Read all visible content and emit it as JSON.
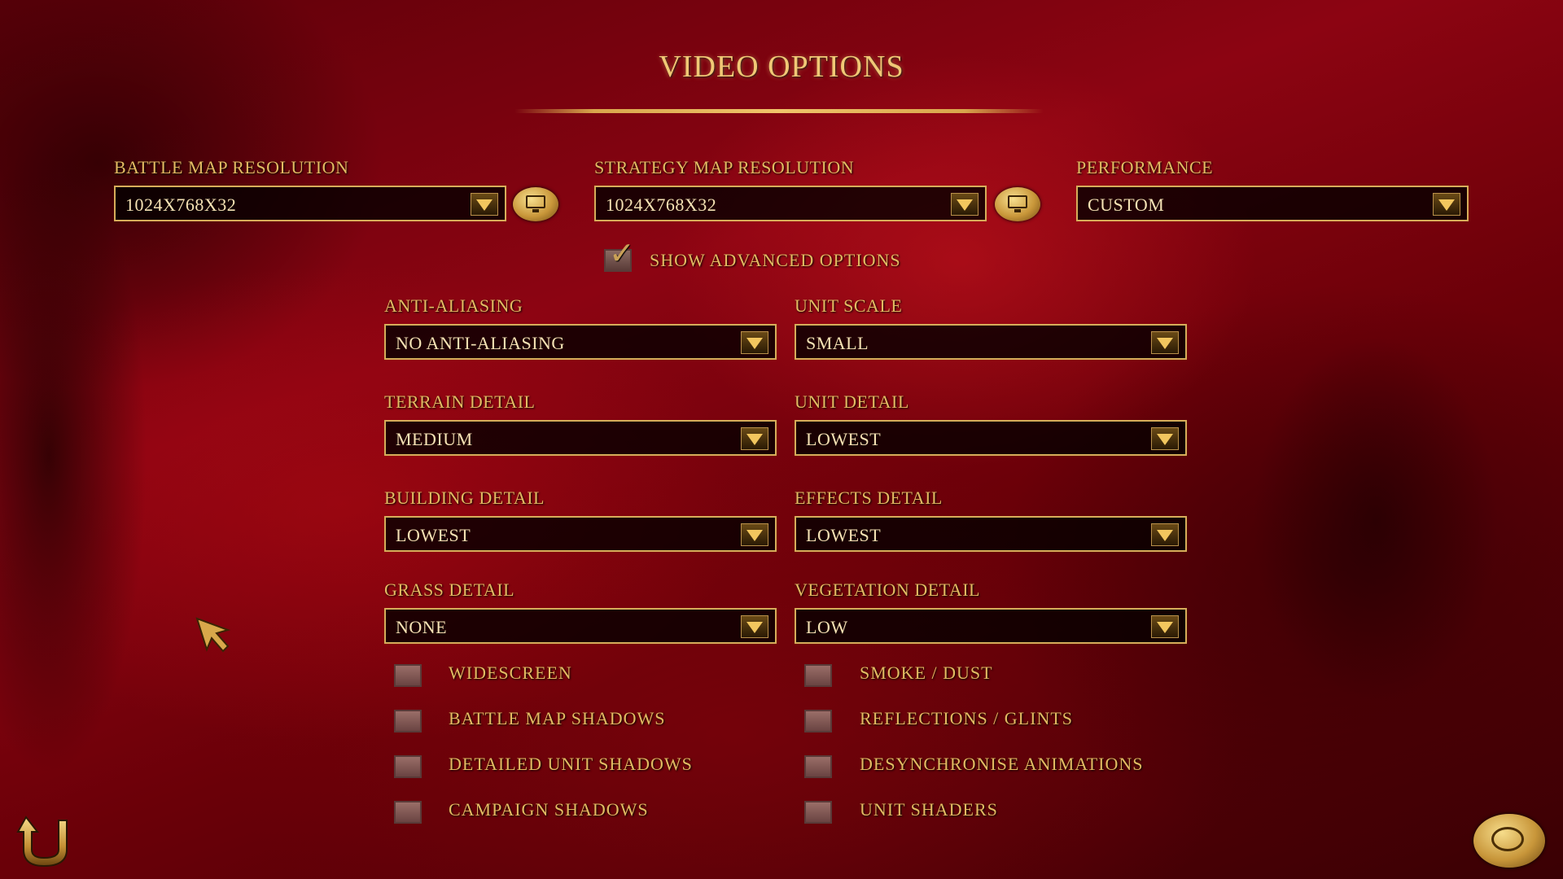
{
  "title": "VIDEO OPTIONS",
  "resolution": {
    "battle_label": "BATTLE MAP RESOLUTION",
    "battle_value": "1024X768X32",
    "strategy_label": "STRATEGY MAP RESOLUTION",
    "strategy_value": "1024X768X32",
    "performance_label": "PERFORMANCE",
    "performance_value": "CUSTOM"
  },
  "advanced": {
    "label": "SHOW ADVANCED OPTIONS",
    "checked": true
  },
  "settings": {
    "anti_aliasing_label": "ANTI-ALIASING",
    "anti_aliasing_value": "NO ANTI-ALIASING",
    "unit_scale_label": "UNIT SCALE",
    "unit_scale_value": "SMALL",
    "terrain_label": "TERRAIN DETAIL",
    "terrain_value": "MEDIUM",
    "unit_detail_label": "UNIT DETAIL",
    "unit_detail_value": "LOWEST",
    "building_label": "BUILDING DETAIL",
    "building_value": "LOWEST",
    "effects_label": "EFFECTS DETAIL",
    "effects_value": "LOWEST",
    "grass_label": "GRASS DETAIL",
    "grass_value": "NONE",
    "vegetation_label": "VEGETATION DETAIL",
    "vegetation_value": "LOW"
  },
  "toggles": {
    "widescreen": "WIDESCREEN",
    "battle_shadows": "BATTLE MAP SHADOWS",
    "detailed_unit_shadows": "DETAILED UNIT SHADOWS",
    "campaign_shadows": "CAMPAIGN SHADOWS",
    "smoke_dust": "SMOKE / DUST",
    "reflections": "REFLECTIONS / GLINTS",
    "desync": "DESYNCHRONISE ANIMATIONS",
    "unit_shaders": "UNIT SHADERS"
  },
  "colors": {
    "accent": "#e2bb62",
    "value_text": "#f4e2b4",
    "background": "#8c0412"
  },
  "icons": {
    "back": "back-arrow-icon",
    "confirm": "confirm-seal-icon",
    "monitor": "monitor-icon",
    "pointer": "mouse-cursor-icon"
  }
}
